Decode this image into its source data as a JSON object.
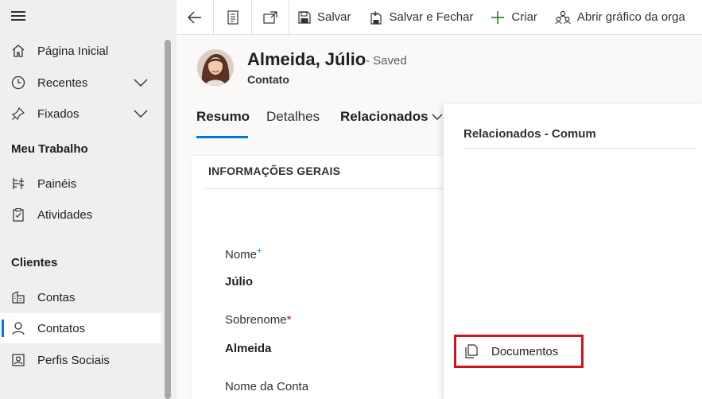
{
  "sidebar": {
    "items": [
      {
        "label": "Página Inicial",
        "icon": "home-icon"
      },
      {
        "label": "Recentes",
        "icon": "clock-icon",
        "expandable": true
      },
      {
        "label": "Fixados",
        "icon": "pin-icon",
        "expandable": true
      }
    ],
    "sections": [
      {
        "title": "Meu Trabalho",
        "items": [
          {
            "label": "Painéis",
            "icon": "dashboard-icon"
          },
          {
            "label": "Atividades",
            "icon": "clipboard-icon"
          }
        ]
      },
      {
        "title": "Clientes",
        "items": [
          {
            "label": "Contas",
            "icon": "building-icon"
          },
          {
            "label": "Contatos",
            "icon": "person-icon",
            "active": true
          },
          {
            "label": "Perfis Sociais",
            "icon": "social-profile-icon"
          }
        ]
      }
    ]
  },
  "toolbar": {
    "save_label": "Salvar",
    "save_close_label": "Salvar e Fechar",
    "create_label": "Criar",
    "org_chart_label": "Abrir gráfico da orga"
  },
  "record": {
    "title": "Almeida, Júlio",
    "status": "- Saved",
    "entity": "Contato"
  },
  "tabs": {
    "summary": "Resumo",
    "details": "Detalhes",
    "related": "Relacionados"
  },
  "form": {
    "section_title": "INFORMAÇÕES GERAIS",
    "fields": {
      "first_name_label": "Nome",
      "first_name_marker": "+",
      "first_name_value": "Júlio",
      "last_name_label": "Sobrenome",
      "last_name_marker": "*",
      "last_name_value": "Almeida",
      "account_label": "Nome da Conta"
    }
  },
  "flyout": {
    "header": "Relacionados - Comum",
    "items": [
      {
        "label": "Documentos",
        "icon": "document-icon"
      }
    ]
  },
  "colors": {
    "accent": "#0078d4",
    "highlight_border": "#d1131a",
    "required": "#a4262c"
  }
}
